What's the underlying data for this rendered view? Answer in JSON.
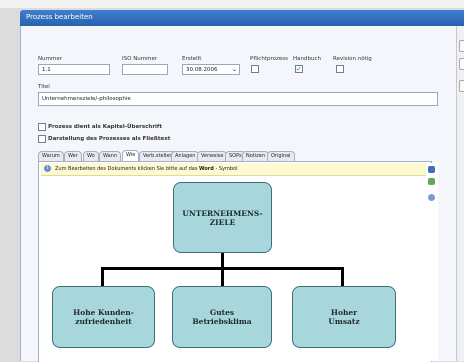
{
  "window": {
    "title": "Prozess bearbeiten"
  },
  "fields": {
    "nummer": {
      "label": "Nummer",
      "value": "1.1"
    },
    "iso": {
      "label": "ISO Nummer",
      "value": ""
    },
    "erstellt": {
      "label": "Erstellt",
      "value": "30.08.2006"
    },
    "pflicht": {
      "label": "Pflichtprozess",
      "checked": false
    },
    "handbuch": {
      "label": "Handbuch",
      "checked": true
    },
    "revision": {
      "label": "Revision nötig",
      "checked": false
    },
    "titel": {
      "label": "Titel",
      "value": "Unternehmensziele/-philosophie"
    }
  },
  "options": {
    "kapitel": {
      "label": "Prozess dient als Kapitel-Überschrift",
      "checked": false
    },
    "fliesstext": {
      "label": "Darstellung des Prozesses als Fließtext",
      "checked": false
    }
  },
  "tabs": [
    "Warum",
    "Wer",
    "Wo",
    "Wann",
    "Wie",
    "Verb.stellen",
    "Anlagen",
    "Verweise",
    "SOPs",
    "Notizen",
    "Original"
  ],
  "active_tab": "Wie",
  "infobar": {
    "text_before": "Zum Bearbeiten des Dokuments klicken Sie bitte auf das ",
    "word": "Word",
    "text_after": " - Symbol"
  },
  "org_chart": {
    "root": "UNTERNEHMENS-\nZIELE",
    "children": [
      "Hohe Kunden-\nzufriedenheit",
      "Gutes\nBetriebsklima",
      "Hoher\nUmsatz"
    ]
  },
  "colors": {
    "titlebar": "#2f6cc0",
    "node_fill": "#a8d6dd",
    "node_border": "#3c6f78",
    "infobar": "#fdf9d2"
  }
}
